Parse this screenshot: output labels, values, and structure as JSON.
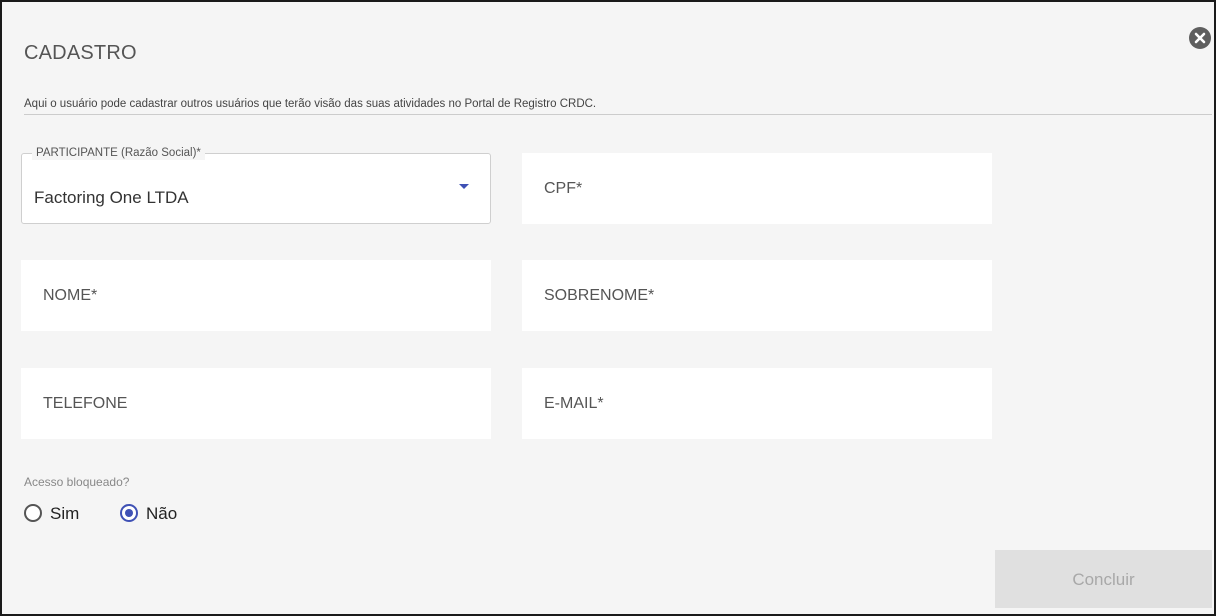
{
  "dialog": {
    "title": "CADASTRO",
    "subtitle": "Aqui o usuário pode cadastrar outros usuários que terão visão das suas atividades no Portal de Registro CRDC.",
    "close_icon": "close-circle-icon"
  },
  "form": {
    "participante": {
      "label": "PARTICIPANTE (Razão Social)*",
      "value": "Factoring One LTDA",
      "caret_icon": "dropdown-caret-icon",
      "caret_color": "#3f51b5"
    },
    "cpf": {
      "placeholder": "CPF*"
    },
    "nome": {
      "placeholder": "NOME*"
    },
    "sobrenome": {
      "placeholder": "SOBRENOME*"
    },
    "telefone": {
      "placeholder": "TELEFONE"
    },
    "email": {
      "placeholder": "E-MAIL*"
    },
    "acesso_bloqueado": {
      "label": "Acesso bloqueado?",
      "options": [
        {
          "label": "Sim",
          "selected": false
        },
        {
          "label": "Não",
          "selected": true
        }
      ],
      "selected_color": "#3f51b5"
    }
  },
  "actions": {
    "submit_label": "Concluir",
    "submit_enabled": false
  }
}
